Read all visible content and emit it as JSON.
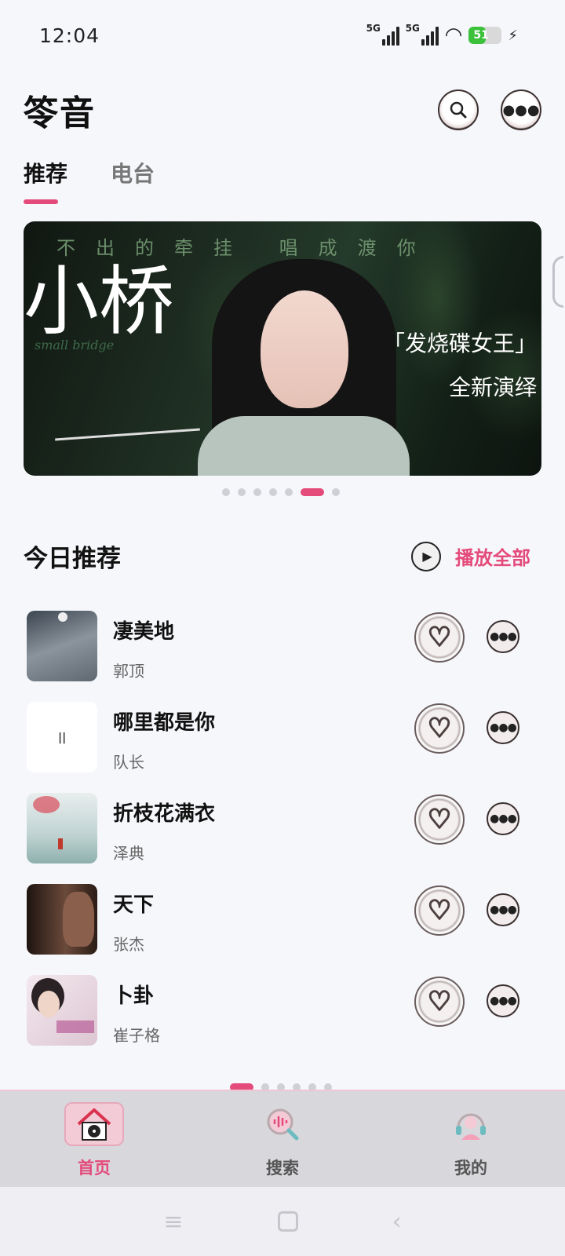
{
  "status_bar": {
    "time": "12:04",
    "sim1": "5G",
    "sim2": "5G",
    "battery": "51",
    "battery_level": 0.51
  },
  "header": {
    "app_title": "笭音",
    "search_icon": "search-icon",
    "more_icon": "more-icon"
  },
  "tabs": [
    {
      "label": "推荐",
      "active": true
    },
    {
      "label": "电台",
      "active": false
    }
  ],
  "banner": {
    "top_text": "不出的牵挂 唱成渡你",
    "big_title": "小桥",
    "script_text": "small bridge",
    "tag_line1": "「发烧碟女王」",
    "tag_line2": "全新演绎",
    "page_count": 7,
    "active_index": 5
  },
  "today": {
    "title": "今日推荐",
    "play_all_label": "播放全部",
    "songs": [
      {
        "title": "凄美地",
        "artist": "郭顶"
      },
      {
        "title": "哪里都是你",
        "artist": "队长"
      },
      {
        "title": "折枝花满衣",
        "artist": "泽典"
      },
      {
        "title": "天下",
        "artist": "张杰"
      },
      {
        "title": "卜卦",
        "artist": "崔子格"
      }
    ],
    "page_count": 6,
    "active_index": 0
  },
  "bottom_nav": [
    {
      "label": "首页",
      "icon": "home-record-icon",
      "active": true
    },
    {
      "label": "搜索",
      "icon": "search-waveform-icon",
      "active": false
    },
    {
      "label": "我的",
      "icon": "headphones-user-icon",
      "active": false
    }
  ],
  "colors": {
    "accent": "#e44a7a",
    "background": "#f6f7fb",
    "nav_background": "#d7d7dc"
  }
}
